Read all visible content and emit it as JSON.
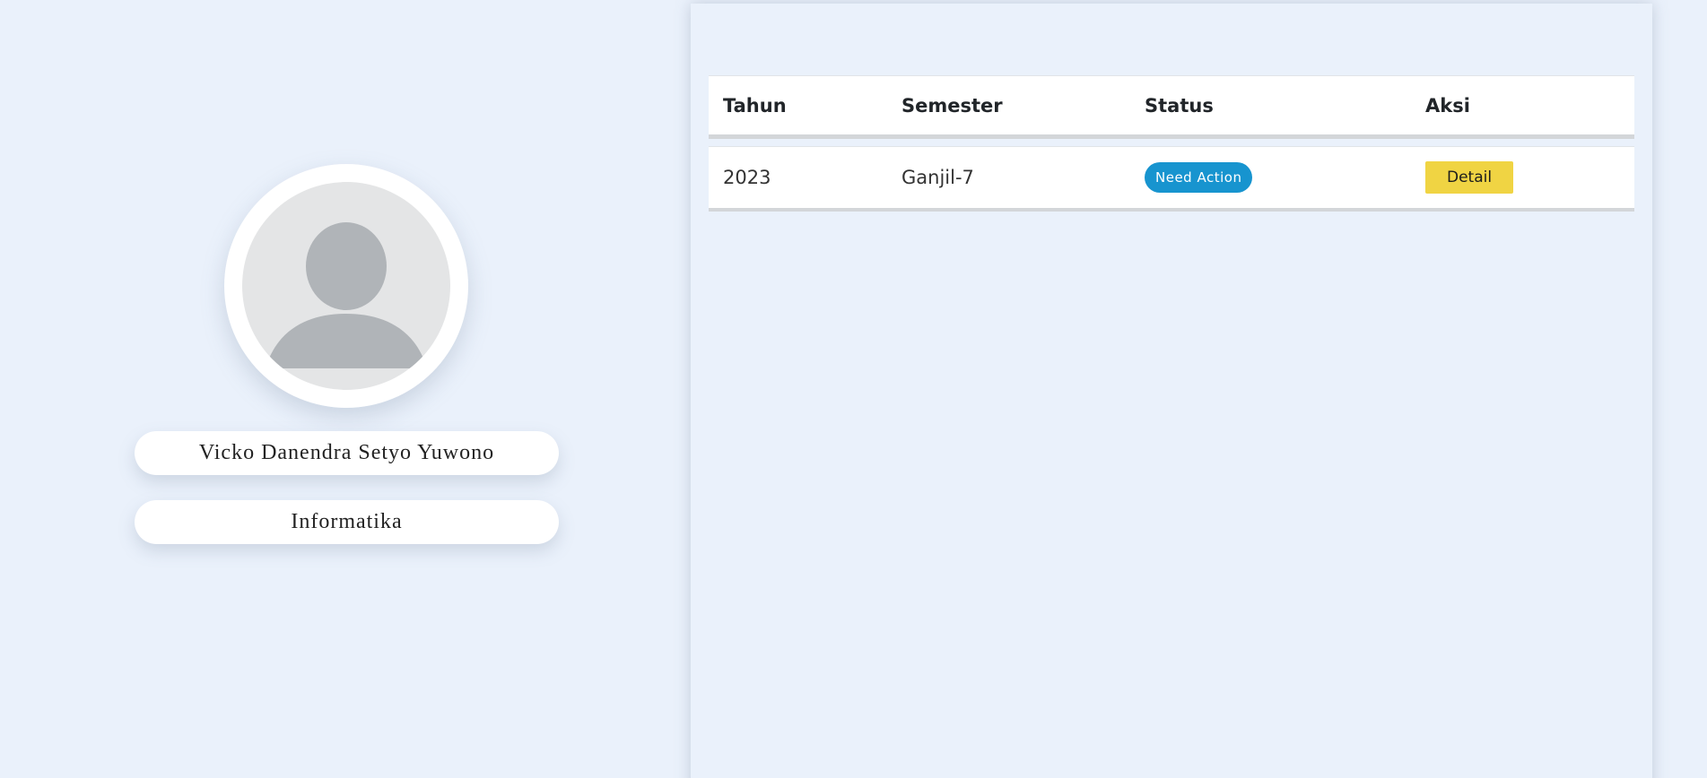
{
  "profile": {
    "name": "Vicko Danendra Setyo Yuwono",
    "program": "Informatika",
    "avatar_icon": "user-silhouette-icon"
  },
  "table": {
    "headers": {
      "year": "Tahun",
      "semester": "Semester",
      "status": "Status",
      "action": "Aksi"
    },
    "rows": [
      {
        "year": "2023",
        "semester": "Ganjil-7",
        "status": "Need Action",
        "action": "Detail"
      }
    ]
  },
  "colors": {
    "background": "#eaf1fb",
    "status_badge": "#1794cf",
    "detail_button": "#f0d443",
    "avatar_bg": "#e4e5e6",
    "avatar_figure": "#b0b4b8"
  }
}
